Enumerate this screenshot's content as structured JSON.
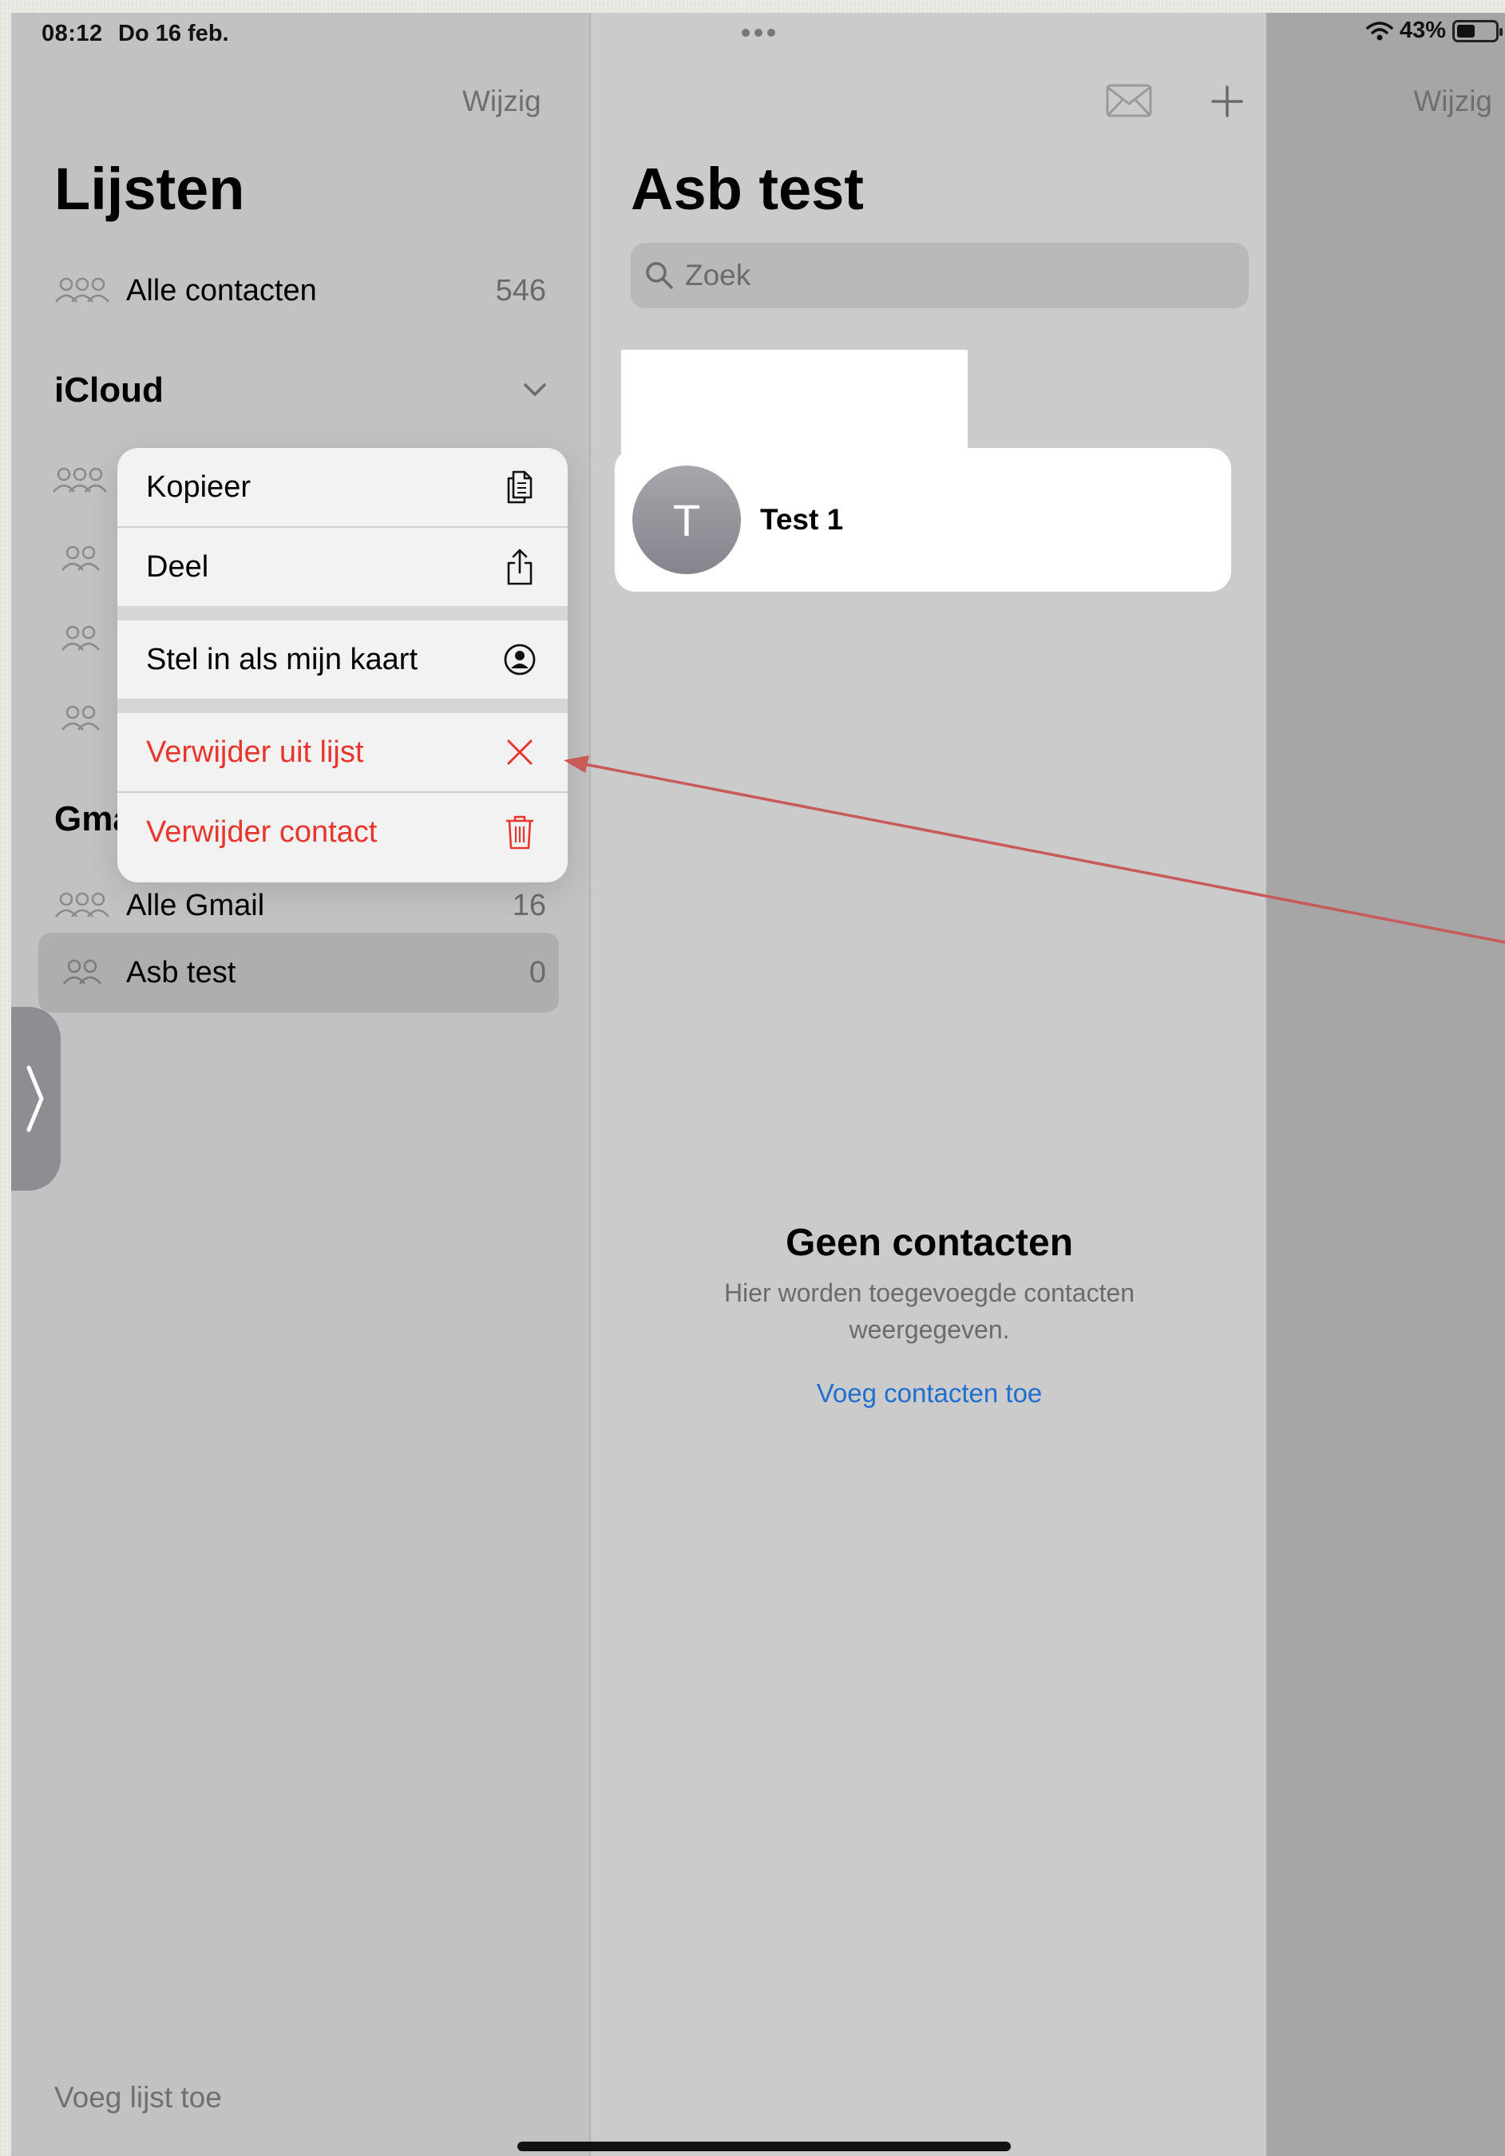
{
  "status_bar": {
    "time": "08:12",
    "date": "Do 16 feb.",
    "battery": "43%"
  },
  "sidebar": {
    "edit_label": "Wijzig",
    "title": "Lijsten",
    "all_contacts": {
      "label": "Alle contacten",
      "count": "546"
    },
    "icloud_header": "iCloud",
    "gmail_header": "Gma",
    "gmail_rows": [
      {
        "label": "Alle Gmail",
        "count": "16"
      },
      {
        "label": "Asb test",
        "count": "0"
      }
    ],
    "add_list_label": "Voeg lijst toe"
  },
  "context_menu": {
    "items": [
      {
        "label": "Kopieer",
        "icon": "copy-icon"
      },
      {
        "label": "Deel",
        "icon": "share-icon"
      },
      {
        "label": "Stel in als mijn kaart",
        "icon": "person-circle-icon"
      },
      {
        "label": "Verwijder uit lijst",
        "icon": "xmark-icon"
      },
      {
        "label": "Verwijder contact",
        "icon": "trash-icon"
      }
    ],
    "destructive_color": "#e8362d"
  },
  "middle": {
    "title": "Asb test",
    "search_placeholder": "Zoek",
    "contact": {
      "initial": "T",
      "name": "Test 1"
    },
    "empty_title": "Geen contacten",
    "empty_subtitle": "Hier worden toegevoegde contacten weergegeven.",
    "empty_link": "Voeg contacten toe"
  },
  "right": {
    "edit_label": "Wijzig"
  },
  "colors": {
    "accent_link": "#1f6fcf",
    "annotation_arrow": "#c85a5a"
  }
}
